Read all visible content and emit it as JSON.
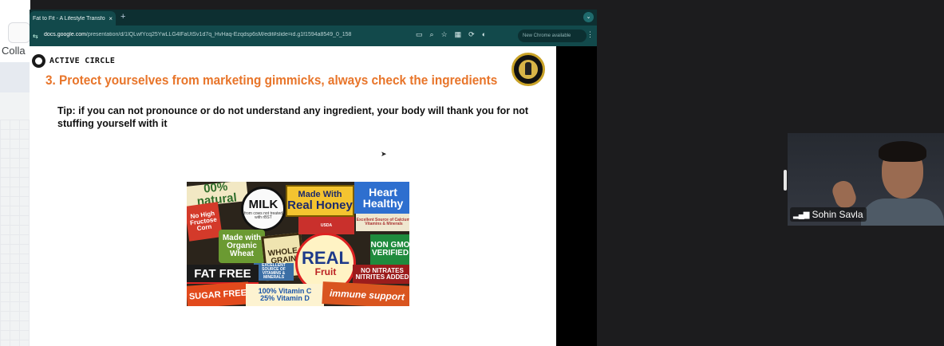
{
  "left_app": {
    "partial_label": "Colla"
  },
  "browser": {
    "tab": {
      "title": "Fat to Fit - A Lifestyle Transfo",
      "close_glyph": "×"
    },
    "new_tab_glyph": "+",
    "tab_menu_glyph": "⌄",
    "address_bar": {
      "host": "docs.google.com",
      "path": "/presentation/d/1lQLwfYcq25YwLLG4lFaUtSv1d7q_HvHaq-Ezqdsp6sM/edit#slide=id.g1f1594a8549_0_158"
    },
    "update_pill": "New Chrome available",
    "kebab_glyph": "⋮",
    "toolbar_icons": [
      "cast-icon",
      "zoom-icon",
      "star-icon",
      "extension-icon",
      "sync-icon",
      "profile-icon"
    ]
  },
  "slide": {
    "logo_text": "ACTIVE CIRCLE",
    "title": "3.  Protect yourselves from marketing gimmicks, always check the ingredients",
    "tip": "Tip: if you can not pronounce or do not understand any ingredient, your body will thank you for not stuffing yourself with it",
    "collage_labels": {
      "natural": "00% natural",
      "milk": "MILK",
      "milk_sub": "from cows not treated with rBST",
      "made_with": "Made With",
      "real_honey": "Real Honey",
      "heart_healthy": "Heart Healthy",
      "no_hfcs": "No High Fructose Corn",
      "organic_wheat": "Made with Organic Wheat",
      "source_banner": "Excellent Source of Calcium, Vitamins & Minerals",
      "real": "REAL",
      "fruit": "Fruit",
      "usda": "USDA",
      "whole_grain": "WHOLE GRAIN",
      "non_gmo": "NON GMO VERIFIED",
      "no_nitrates": "NO NITRATES NITRITES ADDED",
      "fat_free": "FAT FREE",
      "sugar_free": "SUGAR FREE",
      "vitamin_c": "100% Vitamin C",
      "vitamin_c_2": "25% Vitamin D",
      "immune_support": "immune support",
      "excellent_source": "EXCELLENT SOURCE OF VITAMINS & MINERALS"
    }
  },
  "video": {
    "participant_name": "Sohin Savla",
    "signal_glyph": "▂▄▆"
  }
}
